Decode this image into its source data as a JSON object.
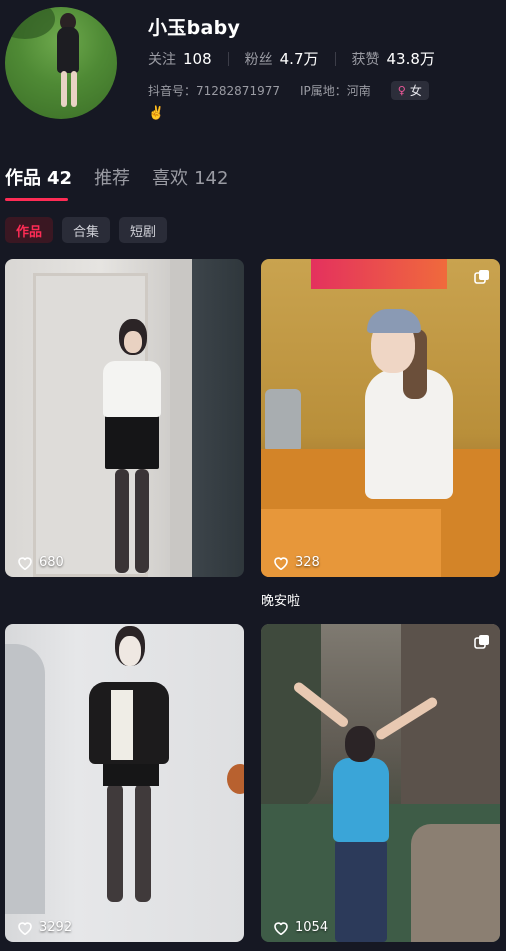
{
  "profile": {
    "username": "小玉baby",
    "stats": [
      {
        "label": "关注",
        "value": "108"
      },
      {
        "label": "粉丝",
        "value": "4.7万"
      },
      {
        "label": "获赞",
        "value": "43.8万"
      }
    ],
    "douyin_id": "抖音号：71282871977",
    "ip_location": "IP属地：河南",
    "gender_symbol": "♀",
    "gender": "女",
    "bio": "✌️"
  },
  "tabs": [
    {
      "label": "作品",
      "count": "42",
      "active": true
    },
    {
      "label": "推荐",
      "count": "",
      "active": false
    },
    {
      "label": "喜欢",
      "count": "142",
      "active": false
    }
  ],
  "chips": [
    {
      "label": "作品",
      "active": true
    },
    {
      "label": "合集",
      "active": false
    },
    {
      "label": "短剧",
      "active": false
    }
  ],
  "videos": [
    {
      "likes": "680",
      "caption": "",
      "multi": false
    },
    {
      "likes": "328",
      "caption": "晚安啦",
      "multi": true
    },
    {
      "likes": "3292",
      "caption": "",
      "multi": false
    },
    {
      "likes": "1054",
      "caption": "",
      "multi": true
    }
  ],
  "colors": {
    "background": "#161823",
    "accent": "#fe2c55",
    "muted_text": "#9a9ba3"
  },
  "icons": {
    "like": "heart-outline-icon",
    "multi": "stack-icon",
    "gender": "female-icon"
  }
}
